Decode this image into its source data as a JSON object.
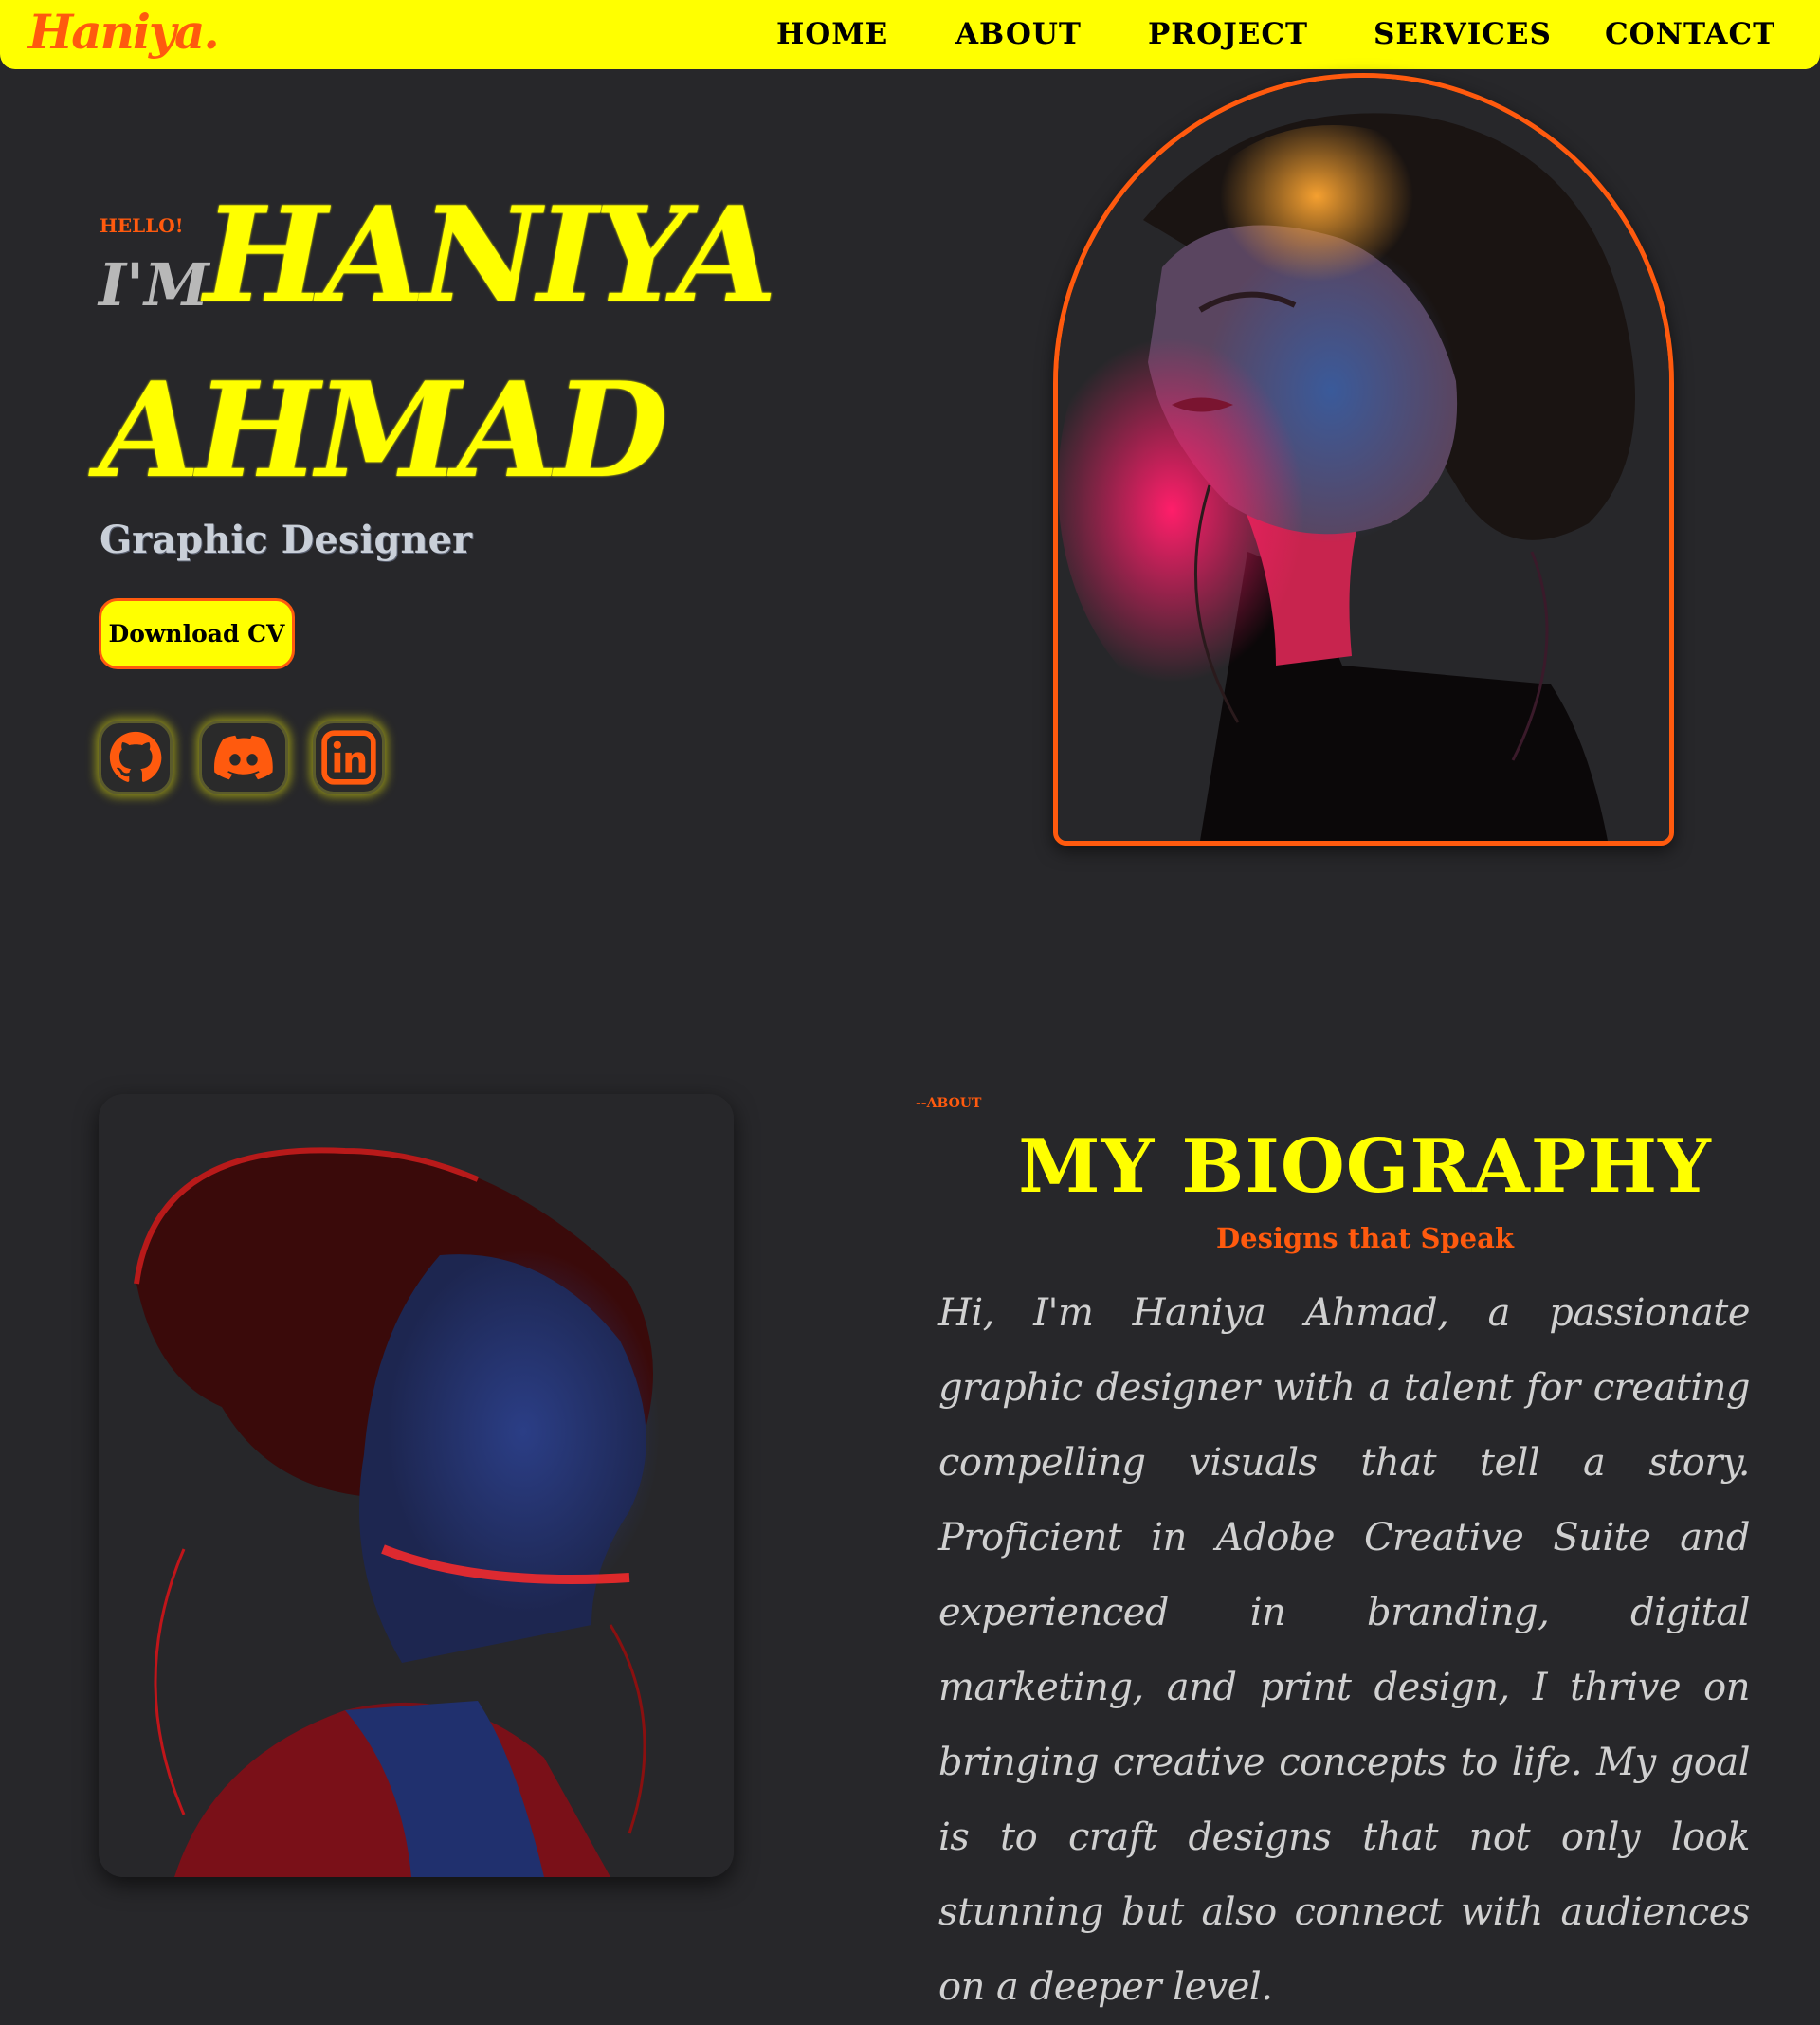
{
  "nav": {
    "logo": "Haniya.",
    "links": [
      "HOME",
      "ABOUT",
      "PROJECT",
      "SERVICES",
      "CONTACT"
    ]
  },
  "hero": {
    "greeting": "HELLO!",
    "intro": "I'M",
    "first_name": "HANIYA",
    "last_name": "AHMAD",
    "role": "Graphic Designer",
    "cv_button": "Download CV",
    "socials": [
      "github-icon",
      "discord-icon",
      "linkedin-icon"
    ]
  },
  "about": {
    "tag": "--ABOUT",
    "title": "MY BIOGRAPHY",
    "subtitle": "Designs that Speak",
    "text": "Hi, I'm Haniya Ahmad, a passionate graphic designer with a talent for creating compelling visuals that tell a story. Proficient in Adobe Creative Suite and experienced in branding, digital marketing, and print design, I thrive on bringing creative concepts to life. My goal is to craft designs that not only look stunning but also connect with audiences on a deeper level."
  },
  "colors": {
    "background": "#27272a",
    "accent_yellow": "#ffff00",
    "accent_orange": "#ff5a0e",
    "text_gray": "#d0d0d0"
  }
}
